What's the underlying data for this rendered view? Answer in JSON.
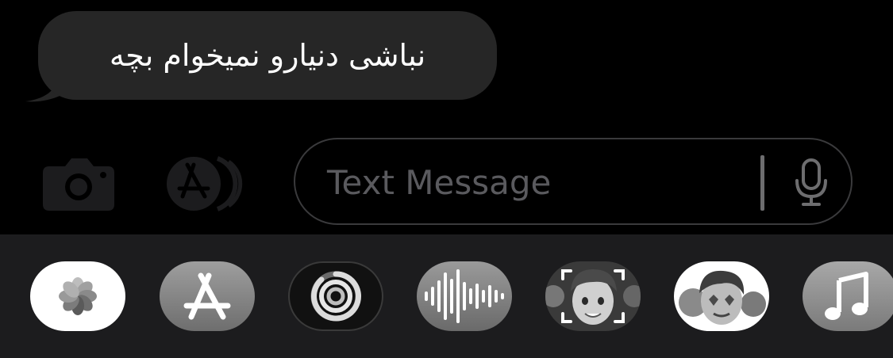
{
  "messages": [
    {
      "direction": "incoming",
      "text": "نباشی دنیارو نمیخوام بچه"
    }
  ],
  "compose": {
    "placeholder": "Text Message",
    "camera_icon": "camera-icon",
    "apps_icon": "app-store-icon",
    "mic_icon": "microphone-icon"
  },
  "app_drawer": {
    "apps": [
      {
        "name": "Photos",
        "icon": "photos-icon"
      },
      {
        "name": "App Store",
        "icon": "app-store-icon"
      },
      {
        "name": "Fitness",
        "icon": "fitness-rings-icon"
      },
      {
        "name": "Audio Message",
        "icon": "waveform-icon"
      },
      {
        "name": "Memoji",
        "icon": "memoji-icon"
      },
      {
        "name": "Memoji Stickers",
        "icon": "memoji-stickers-icon"
      },
      {
        "name": "Music",
        "icon": "music-note-icon"
      }
    ]
  },
  "colors": {
    "background": "#000000",
    "bubble": "#262626",
    "drawer": "#1c1c1e",
    "placeholder": "#5a5a5e"
  }
}
